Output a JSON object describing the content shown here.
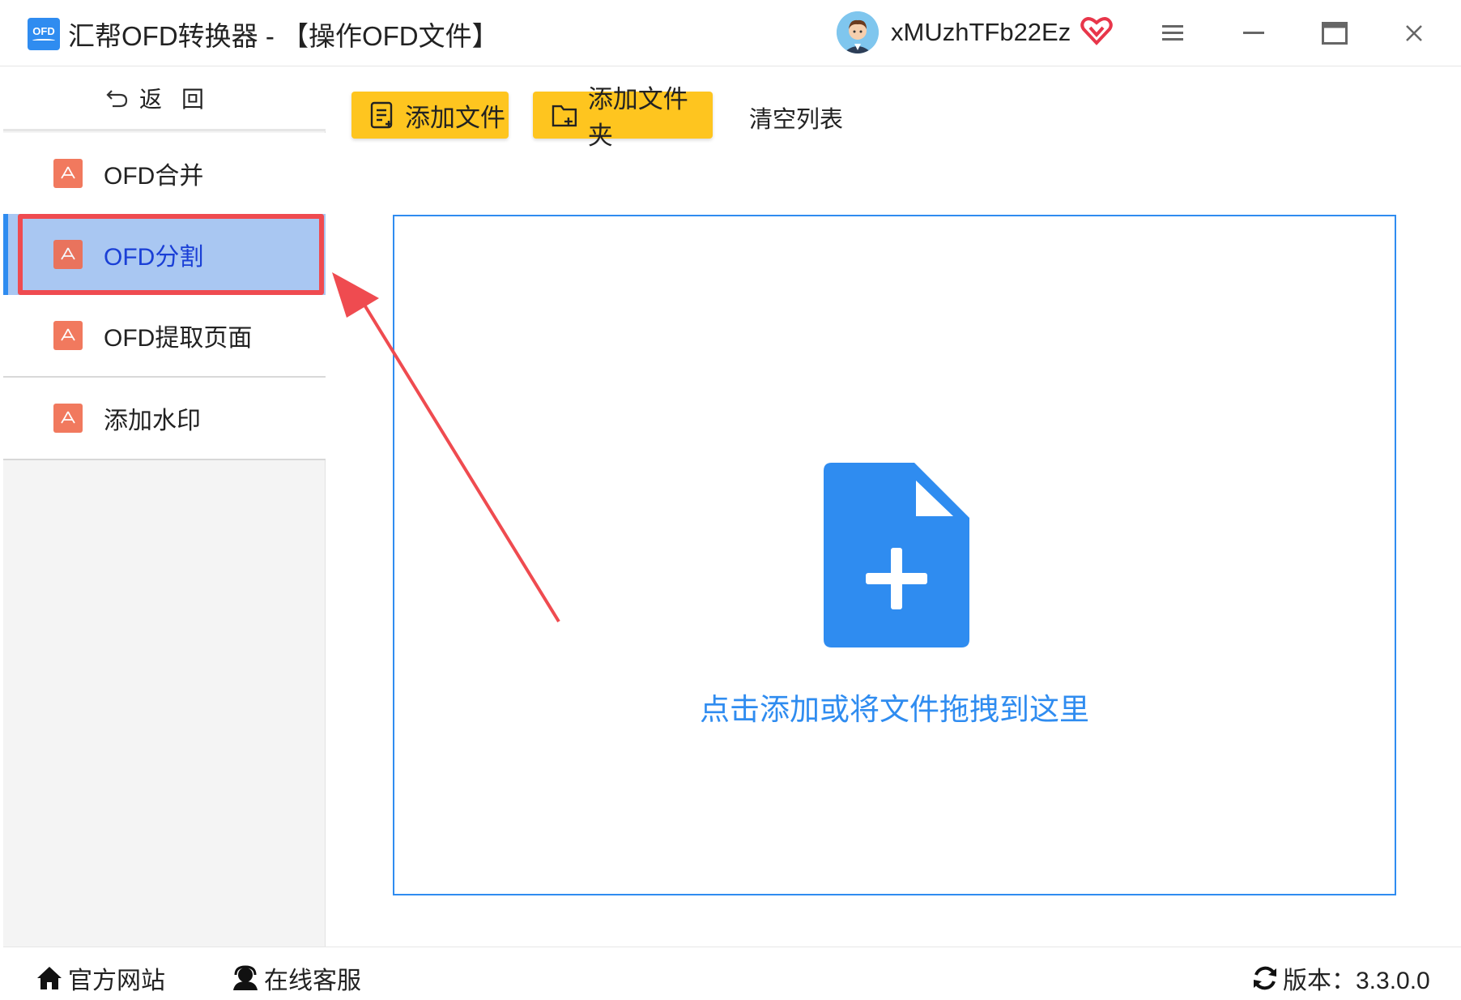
{
  "window": {
    "title": "汇帮OFD转换器 - 【操作OFD文件】",
    "logo_text": "OFD",
    "username": "xMUzhTFb22Ez"
  },
  "sidebar": {
    "back_label": "返回",
    "items": [
      {
        "label": "OFD合并"
      },
      {
        "label": "OFD分割"
      },
      {
        "label": "OFD提取页面"
      },
      {
        "label": "添加水印"
      }
    ],
    "active_index": 1
  },
  "toolbar": {
    "add_file_label": "添加文件",
    "add_folder_label": "添加文件夹",
    "clear_label": "清空列表"
  },
  "dropzone": {
    "hint": "点击添加或将文件拖拽到这里"
  },
  "footer": {
    "site_label": "官方网站",
    "service_label": "在线客服",
    "version_label": "版本：3.3.0.0"
  },
  "colors": {
    "accent": "#2f8cf0",
    "button_yellow": "#fec51f",
    "active_item": "#a9c7f2",
    "annotation_red": "#ef4b50",
    "pdf_icon": "#f06b4d"
  },
  "icons": {
    "logo": "ofd-logo-icon",
    "avatar": "avatar",
    "vip": "vip-heart-icon",
    "menu": "menu-icon",
    "minimize": "minimize-icon",
    "maximize": "maximize-icon",
    "close": "close-icon",
    "back": "back-arrow-icon",
    "nav": "pdf-file-icon",
    "add_file": "file-list-icon",
    "add_folder": "folder-plus-icon",
    "drop": "file-add-icon",
    "site": "home-icon",
    "service": "headset-user-icon",
    "version": "refresh-icon"
  }
}
